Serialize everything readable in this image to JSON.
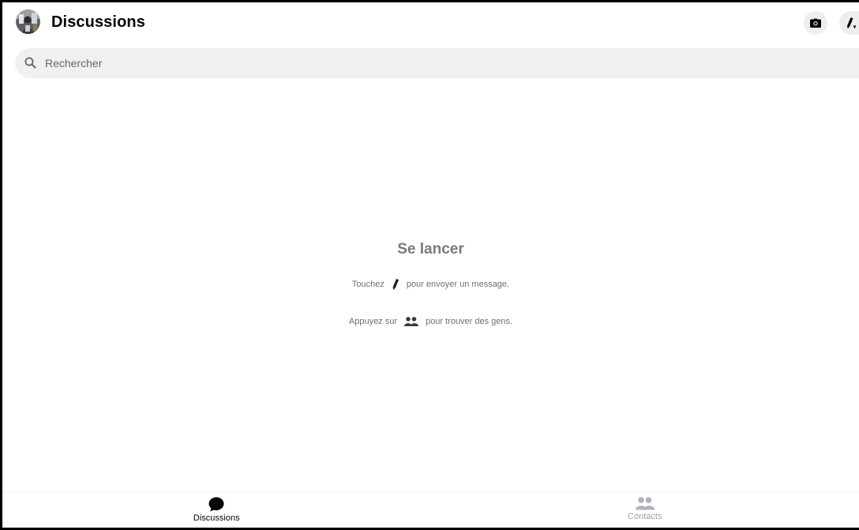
{
  "header": {
    "title": "Discussions",
    "avatar_icon": "user-avatar",
    "camera_icon": "camera-icon",
    "compose_icon": "compose-pencil-icon"
  },
  "search": {
    "placeholder": "Rechercher",
    "value": ""
  },
  "empty_state": {
    "title": "Se lancer",
    "line1_before": "Touchez",
    "line1_after": "pour envoyer un message.",
    "line2_before": "Appuyez sur",
    "line2_after": "pour trouver des gens."
  },
  "bottom_nav": {
    "tabs": [
      {
        "label": "Discussions",
        "icon": "chat-bubble-icon",
        "active": true
      },
      {
        "label": "Contacts",
        "icon": "people-icon",
        "active": false
      }
    ]
  },
  "colors": {
    "active_text": "#050505",
    "inactive_text": "#a0a0a0",
    "muted_text": "#6f6f6f",
    "search_bg": "#f0f0f0"
  }
}
